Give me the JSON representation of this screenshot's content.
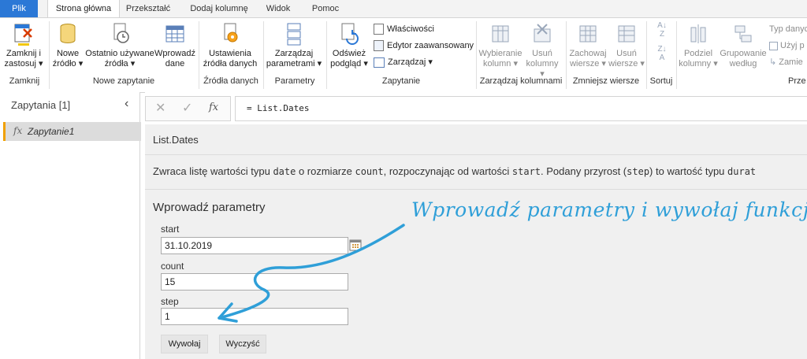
{
  "menu": {
    "tabs": [
      "Plik",
      "Strona główna",
      "Przekształć",
      "Dodaj kolumnę",
      "Widok",
      "Pomoc"
    ]
  },
  "ribbon": {
    "close_apply": [
      "Zamknij i",
      "zastosuj ▾"
    ],
    "new_source": [
      "Nowe",
      "źródło ▾"
    ],
    "recent_sources": [
      "Ostatnio używane",
      "źródła ▾"
    ],
    "enter_data": [
      "Wprowadź",
      "dane"
    ],
    "data_source_settings": [
      "Ustawienia",
      "źródła danych"
    ],
    "manage_params": [
      "Zarządzaj",
      "parametrami ▾"
    ],
    "refresh_preview": [
      "Odśwież",
      "podgląd ▾"
    ],
    "properties": "Właściwości",
    "advanced_editor": "Edytor zaawansowany",
    "manage": "Zarządzaj ▾",
    "choose_columns": [
      "Wybieranie",
      "kolumn ▾"
    ],
    "remove_columns": [
      "Usuń",
      "kolumny ▾"
    ],
    "keep_rows": [
      "Zachowaj",
      "wiersze ▾"
    ],
    "remove_rows": [
      "Usuń",
      "wiersze ▾"
    ],
    "split_column": [
      "Podziel",
      "kolumny ▾"
    ],
    "group_by": [
      "Grupowanie",
      "według"
    ],
    "data_type": "Typ danyc",
    "use_first_row": "Użyj p",
    "replace_values": "Zamie",
    "groups": {
      "close": "Zamknij",
      "new_query": "Nowe zapytanie",
      "data_sources": "Źródła danych",
      "parameters": "Parametry",
      "query": "Zapytanie",
      "manage_columns": "Zarządzaj kolumnami",
      "reduce_rows": "Zmniejsz wiersze",
      "sort": "Sortuj",
      "transform": "Prze"
    }
  },
  "queries": {
    "title": "Zapytania [1]",
    "items": [
      "Zapytanie1"
    ]
  },
  "formula": {
    "fx": "fx",
    "text": "= List.Dates"
  },
  "function": {
    "name": "List.Dates",
    "desc_parts": [
      "Zwraca listę wartości typu ",
      "date",
      " o rozmiarze ",
      "count",
      ", rozpoczynając od wartości ",
      "start",
      ". Podany przyrost (",
      "step",
      ") to wartość typu ",
      "durat"
    ]
  },
  "params": {
    "title": "Wprowadź parametry",
    "start_label": "start",
    "start_value": "31.10.2019",
    "count_label": "count",
    "count_value": "15",
    "step_label": "step",
    "step_value": "1",
    "invoke": "Wywołaj",
    "clear": "Wyczyść"
  },
  "annotation": "Wprowadź parametry i wywołaj funkcję",
  "colors": {
    "accent": "#2b78d6",
    "annotation": "#2f9fd8",
    "query_marker": "#f0a000"
  }
}
